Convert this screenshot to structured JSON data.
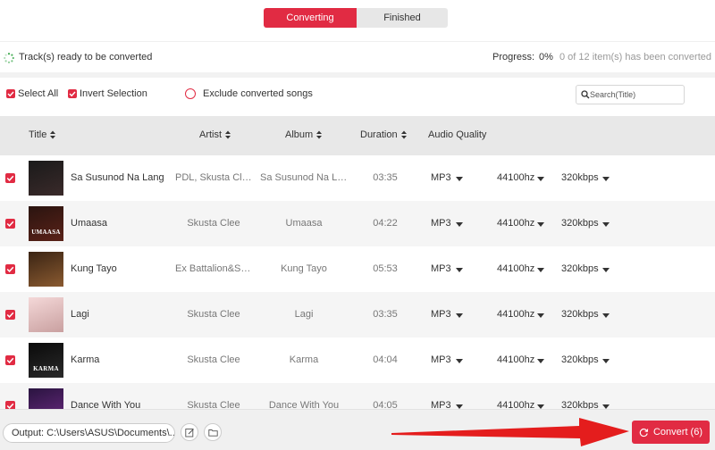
{
  "tabs": [
    {
      "label": "Converting",
      "active": true
    },
    {
      "label": "Finished",
      "active": false
    }
  ],
  "status": {
    "text": "Track(s) ready to be converted",
    "progress_label": "Progress:",
    "progress_value": "0%",
    "progress_detail": "0 of 12 item(s) has been converted"
  },
  "toolbar": {
    "select_all": "Select All",
    "invert_selection": "Invert Selection",
    "exclude_converted": "Exclude converted songs",
    "search_placeholder": "Search(Title)"
  },
  "columns": {
    "title": "Title",
    "artist": "Artist",
    "album": "Album",
    "duration": "Duration",
    "quality": "Audio Quality"
  },
  "tracks": [
    {
      "title": "Sa Susunod Na Lang",
      "artist": "PDL, Skusta Clee",
      "album": "Sa Susunod Na Lang",
      "duration": "03:35",
      "format": "MP3",
      "sample_rate": "44100hz",
      "bitrate": "320kbps",
      "cover_text": ""
    },
    {
      "title": "Umaasa",
      "artist": "Skusta Clee",
      "album": "Umaasa",
      "duration": "04:22",
      "format": "MP3",
      "sample_rate": "44100hz",
      "bitrate": "320kbps",
      "cover_text": "UMAASA"
    },
    {
      "title": "Kung Tayo",
      "artist": "Ex Battalion&Skusta Clee",
      "album": "Kung Tayo",
      "duration": "05:53",
      "format": "MP3",
      "sample_rate": "44100hz",
      "bitrate": "320kbps",
      "cover_text": ""
    },
    {
      "title": "Lagi",
      "artist": "Skusta Clee",
      "album": "Lagi",
      "duration": "03:35",
      "format": "MP3",
      "sample_rate": "44100hz",
      "bitrate": "320kbps",
      "cover_text": ""
    },
    {
      "title": "Karma",
      "artist": "Skusta Clee",
      "album": "Karma",
      "duration": "04:04",
      "format": "MP3",
      "sample_rate": "44100hz",
      "bitrate": "320kbps",
      "cover_text": "KARMA"
    },
    {
      "title": "Dance With You",
      "artist": "Skusta Clee",
      "album": "Dance With You",
      "duration": "04:05",
      "format": "MP3",
      "sample_rate": "44100hz",
      "bitrate": "320kbps",
      "cover_text": ""
    }
  ],
  "bottom": {
    "output": "Output: C:\\Users\\ASUS\\Documents\\...",
    "convert_label": "Convert (6)"
  },
  "colors": {
    "accent": "#e12b43"
  }
}
